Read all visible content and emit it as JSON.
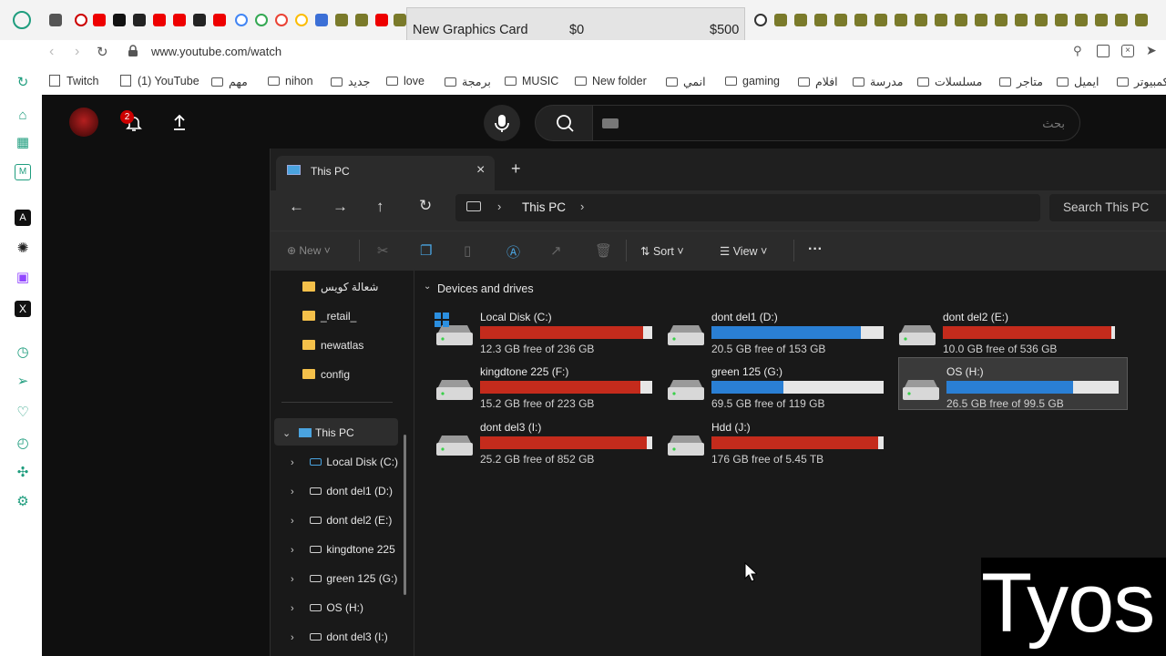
{
  "browser": {
    "url": "www.youtube.com/watch",
    "bookmarks": [
      {
        "label": "Twitch"
      },
      {
        "label": "(1) YouTube"
      },
      {
        "label": "مهم"
      },
      {
        "label": "nihon"
      },
      {
        "label": "جديد"
      },
      {
        "label": "love"
      },
      {
        "label": "برمجة"
      },
      {
        "label": "MUSIC"
      },
      {
        "label": "New folder"
      },
      {
        "label": "انمي"
      },
      {
        "label": "gaming"
      },
      {
        "label": "افلام"
      },
      {
        "label": "مدرسة"
      },
      {
        "label": "مسلسلات"
      },
      {
        "label": "متاجر"
      },
      {
        "label": "ايميل"
      },
      {
        "label": "كمبيوتر"
      }
    ],
    "tooltip": {
      "title": "New Graphics Card",
      "min": "$0",
      "max": "$500"
    }
  },
  "youtube": {
    "notification_count": "2",
    "search_placeholder": "بحث"
  },
  "explorer": {
    "tab_title": "This PC",
    "breadcrumb": "This PC",
    "search_placeholder": "Search This PC",
    "toolbar": {
      "new": "New",
      "sort": "Sort",
      "view": "View"
    },
    "section_header": "Devices and drives",
    "drives": [
      {
        "name": "Local Disk (C:)",
        "free": "12.3 GB free of 236 GB",
        "used_fraction": 0.948,
        "color": "#c42b1c",
        "os": true
      },
      {
        "name": "dont del1 (D:)",
        "free": "20.5 GB free of 153 GB",
        "used_fraction": 0.866,
        "color": "#2a7fd4"
      },
      {
        "name": "dont del2 (E:)",
        "free": "10.0 GB free of 536 GB",
        "used_fraction": 0.981,
        "color": "#c42b1c"
      },
      {
        "name": "kingdtone 225 (F:)",
        "free": "15.2 GB free of 223 GB",
        "used_fraction": 0.932,
        "color": "#c42b1c"
      },
      {
        "name": "green 125 (G:)",
        "free": "69.5 GB free of 119 GB",
        "used_fraction": 0.416,
        "color": "#2a7fd4"
      },
      {
        "name": "OS (H:)",
        "free": "26.5 GB free of 99.5 GB",
        "used_fraction": 0.734,
        "color": "#2a7fd4",
        "selected": true
      },
      {
        "name": "dont del3 (I:)",
        "free": "25.2 GB free of 852 GB",
        "used_fraction": 0.97,
        "color": "#c42b1c"
      },
      {
        "name": "Hdd (J:)",
        "free": "176 GB free of 5.45 TB",
        "used_fraction": 0.968,
        "color": "#c42b1c"
      }
    ],
    "nav_folders": [
      "شعالة كويس",
      "_retail_",
      "newatlas",
      "config"
    ],
    "nav_this_pc": "This PC",
    "nav_drives": [
      "Local Disk (C:)",
      "dont del1 (D:)",
      "dont del2 (E:)",
      "kingdtone 225",
      "green 125 (G:)",
      "OS (H:)",
      "dont del3 (I:)"
    ]
  },
  "watermark": "Tyos"
}
